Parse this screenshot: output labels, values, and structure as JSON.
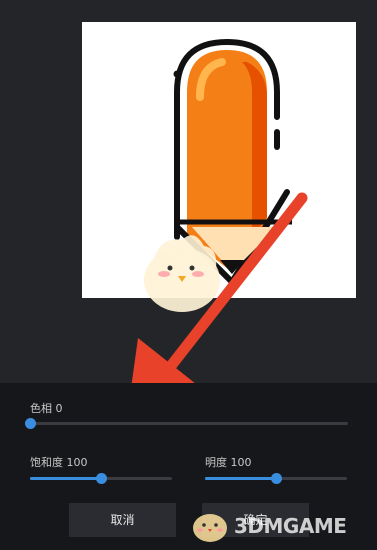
{
  "editor": {
    "hue": {
      "label": "色相 0",
      "value": 0,
      "min": -180,
      "max": 180
    },
    "saturation": {
      "label": "饱和度 100",
      "value": 100,
      "min": 0,
      "max": 200
    },
    "brightness": {
      "label": "明度 100",
      "value": 100,
      "min": 0,
      "max": 200
    }
  },
  "actions": {
    "cancel_label": "取消",
    "confirm_label": "确定"
  },
  "watermark": {
    "text": "3DMGAME"
  },
  "colors": {
    "accent": "#3a8ee0",
    "arrow": "#e8422a",
    "pencil_body": "#f57f17",
    "panel_bg": "#16171a"
  }
}
